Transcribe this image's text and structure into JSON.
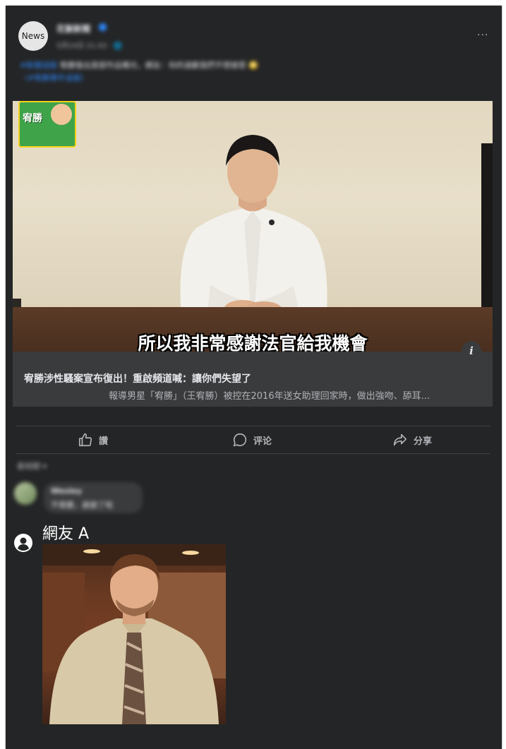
{
  "post": {
    "avatar_text": "News",
    "page_name": "花絮新聞",
    "post_meta": "5月24日 21:43 · 🌐",
    "more_icon": "···",
    "caption_tag": "#新聞追蹤",
    "caption_text": " 宥勝復出首部作品曝光，網友：你的道歉我們不想接受 🙄",
    "caption_link": "（#宥勝事件追蹤）"
  },
  "media": {
    "badge_text": "宥勝",
    "subtitle": "所以我非常感謝法官給我機會",
    "info_icon": "i"
  },
  "link_preview": {
    "title": "宥勝涉性騷案宣布復出！重啟頻道喊：讓你們失望了",
    "description": "報導男星「宥勝」（王宥勝）被控在2016年送女助理回家時，做出強吻、舔耳..."
  },
  "actions": {
    "like": "讚",
    "comment": "评论",
    "share": "分享"
  },
  "comments": {
    "sort_label": "最相關 ▾",
    "blurred_name": "Wesley",
    "blurred_text": "不需要，謝謝了啦"
  },
  "overlay_comment": {
    "user_name": "網友 A"
  },
  "colors": {
    "background": "#242526",
    "text": "#e4e6eb",
    "muted": "#b0b3b8",
    "link": "#2d88ff"
  }
}
